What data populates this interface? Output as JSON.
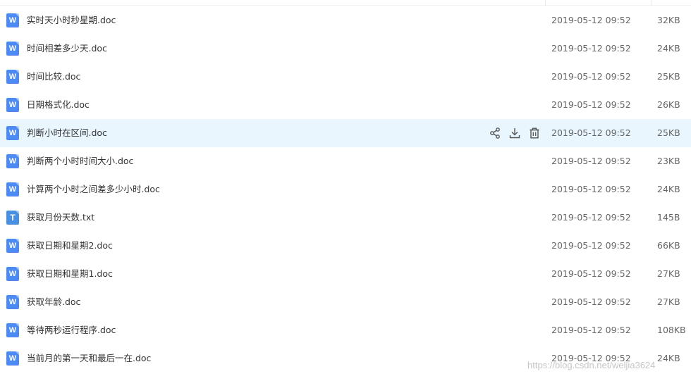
{
  "files": [
    {
      "name": "实时天小时秒星期.doc",
      "date": "2019-05-12 09:52",
      "size": "32KB",
      "type_icon": "W",
      "icon": "word-doc-icon",
      "hovered": false
    },
    {
      "name": "时间相差多少天.doc",
      "date": "2019-05-12 09:52",
      "size": "24KB",
      "type_icon": "W",
      "icon": "word-doc-icon",
      "hovered": false
    },
    {
      "name": "时间比较.doc",
      "date": "2019-05-12 09:52",
      "size": "25KB",
      "type_icon": "W",
      "icon": "word-doc-icon",
      "hovered": false
    },
    {
      "name": "日期格式化.doc",
      "date": "2019-05-12 09:52",
      "size": "26KB",
      "type_icon": "W",
      "icon": "word-doc-icon",
      "hovered": false
    },
    {
      "name": "判断小时在区间.doc",
      "date": "2019-05-12 09:52",
      "size": "25KB",
      "type_icon": "W",
      "icon": "word-doc-icon",
      "hovered": true
    },
    {
      "name": "判断两个小时时间大小.doc",
      "date": "2019-05-12 09:52",
      "size": "23KB",
      "type_icon": "W",
      "icon": "word-doc-icon",
      "hovered": false
    },
    {
      "name": "计算两个小时之间差多少小时.doc",
      "date": "2019-05-12 09:52",
      "size": "24KB",
      "type_icon": "W",
      "icon": "word-doc-icon",
      "hovered": false
    },
    {
      "name": "获取月份天数.txt",
      "date": "2019-05-12 09:52",
      "size": "145B",
      "type_icon": "T",
      "icon": "text-file-icon",
      "hovered": false
    },
    {
      "name": "获取日期和星期2.doc",
      "date": "2019-05-12 09:52",
      "size": "66KB",
      "type_icon": "W",
      "icon": "word-doc-icon",
      "hovered": false
    },
    {
      "name": "获取日期和星期1.doc",
      "date": "2019-05-12 09:52",
      "size": "27KB",
      "type_icon": "W",
      "icon": "word-doc-icon",
      "hovered": false
    },
    {
      "name": "获取年龄.doc",
      "date": "2019-05-12 09:52",
      "size": "27KB",
      "type_icon": "W",
      "icon": "word-doc-icon",
      "hovered": false
    },
    {
      "name": "等待两秒运行程序.doc",
      "date": "2019-05-12 09:52",
      "size": "108KB",
      "type_icon": "W",
      "icon": "word-doc-icon",
      "hovered": false
    },
    {
      "name": "当前月的第一天和最后一在.doc",
      "date": "2019-05-12 09:52",
      "size": "24KB",
      "type_icon": "W",
      "icon": "word-doc-icon",
      "hovered": false
    }
  ],
  "row_actions": [
    {
      "icon": "share-icon"
    },
    {
      "icon": "download-icon"
    },
    {
      "icon": "trash-icon"
    }
  ],
  "colors": {
    "hover_row": "#e9f6fd",
    "word_icon": "#4c8bf5",
    "text_icon": "#4a90e2",
    "action_icon": "#555555"
  },
  "watermark": "https://blog.csdn.net/weljia3624"
}
